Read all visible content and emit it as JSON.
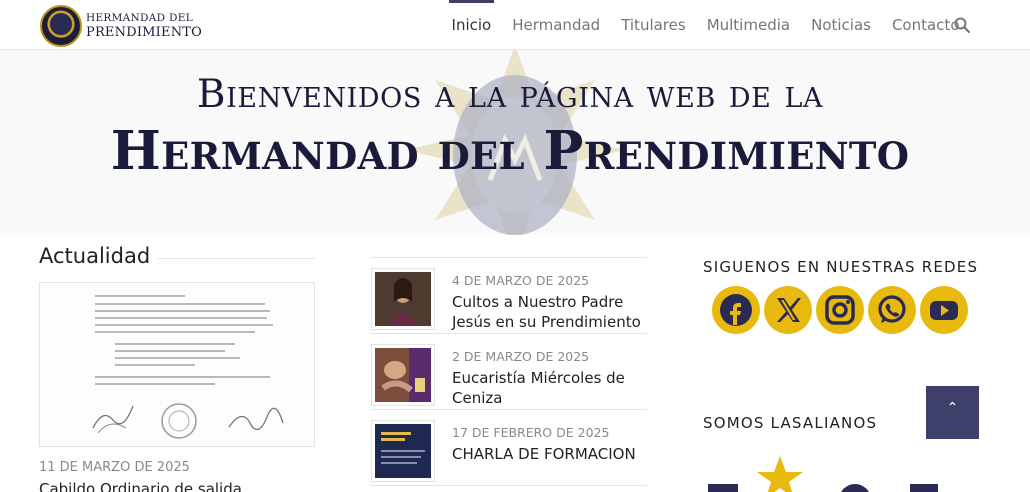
{
  "header": {
    "logo_line1": "Hermandad del",
    "logo_line2": "Prendimiento",
    "nav": [
      "Inicio",
      "Hermandad",
      "Titulares",
      "Multimedia",
      "Noticias",
      "Contacto"
    ],
    "active_nav": "Inicio",
    "search_icon": "search-icon"
  },
  "hero": {
    "line1": "Bienvenidos a la página web de la",
    "line2": "Hermandad del Prendimiento"
  },
  "left": {
    "section_title": "Actualidad",
    "featured_date": "11 DE MARZO DE 2025",
    "featured_title": "Cabildo Ordinario de salida"
  },
  "posts": [
    {
      "date": "4 DE MARZO DE 2025",
      "title": "Cultos a Nuestro Padre Jesús en su Prendimiento"
    },
    {
      "date": "2 DE MARZO DE 2025",
      "title": "Eucaristía Miércoles de Ceniza"
    },
    {
      "date": "17 DE FEBRERO DE 2025",
      "title": "CHARLA DE FORMACION"
    }
  ],
  "right": {
    "social_title": "SIGUENOS EN NUESTRAS REDES",
    "social_icons": [
      "facebook-icon",
      "x-icon",
      "instagram-icon",
      "whatsapp-icon",
      "youtube-icon"
    ],
    "lasalle_title": "SOMOS LASALIANOS"
  },
  "colors": {
    "accent": "#3f3f6b",
    "social": "#e8b90e",
    "hero_text": "#1a1a3a"
  }
}
